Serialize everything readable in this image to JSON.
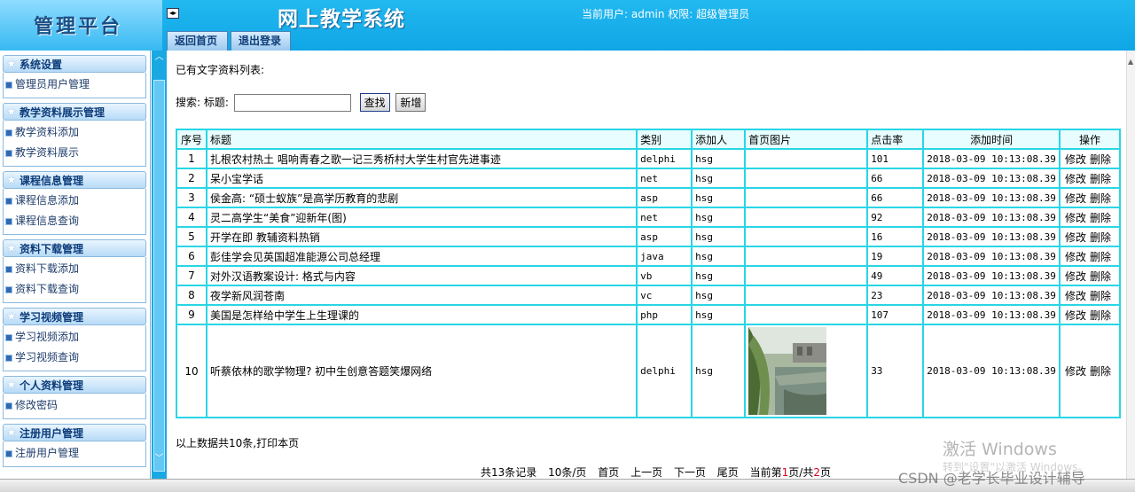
{
  "header": {
    "logo_text": "管理平台",
    "system_title": "网上教学系统",
    "user_info": "当前用户: admin 权限: 超级管理员",
    "tabs": [
      {
        "label": "返回首页"
      },
      {
        "label": "退出登录"
      }
    ]
  },
  "sidebar": {
    "groups": [
      {
        "title": "系统设置",
        "items": [
          {
            "label": "管理员用户管理"
          }
        ]
      },
      {
        "title": "教学资料展示管理",
        "items": [
          {
            "label": "教学资料添加"
          },
          {
            "label": "教学资料展示"
          }
        ]
      },
      {
        "title": "课程信息管理",
        "items": [
          {
            "label": "课程信息添加"
          },
          {
            "label": "课程信息查询"
          }
        ]
      },
      {
        "title": "资料下载管理",
        "items": [
          {
            "label": "资料下载添加"
          },
          {
            "label": "资料下载查询"
          }
        ]
      },
      {
        "title": "学习视频管理",
        "items": [
          {
            "label": "学习视频添加"
          },
          {
            "label": "学习视频查询"
          }
        ]
      },
      {
        "title": "个人资料管理",
        "items": [
          {
            "label": "修改密码"
          }
        ]
      },
      {
        "title": "注册用户管理",
        "items": [
          {
            "label": "注册用户管理"
          }
        ]
      }
    ]
  },
  "main": {
    "list_title": "已有文字资料列表:",
    "search": {
      "label": "搜索: 标题:",
      "value": "",
      "search_button": "查找",
      "add_button": "新增"
    },
    "table": {
      "headers": [
        "序号",
        "标题",
        "类别",
        "添加人",
        "首页图片",
        "点击率",
        "添加时间",
        "操作"
      ],
      "edit_label": "修改",
      "delete_label": "删除",
      "rows": [
        {
          "no": "1",
          "title": "扎根农村热土 唱响青春之歌一记三秀桥村大学生村官先进事迹",
          "category": "delphi",
          "author": "hsg",
          "image": "",
          "clicks": "101",
          "time": "2018-03-09 10:13:08.39"
        },
        {
          "no": "2",
          "title": "呆小宝学话",
          "category": "net",
          "author": "hsg",
          "image": "",
          "clicks": "66",
          "time": "2018-03-09 10:13:08.39"
        },
        {
          "no": "3",
          "title": "侯金高: “硕士蚁族”是高学历教育的悲剧",
          "category": "asp",
          "author": "hsg",
          "image": "",
          "clicks": "66",
          "time": "2018-03-09 10:13:08.39"
        },
        {
          "no": "4",
          "title": "灵二高学生“美食”迎新年(图)",
          "category": "net",
          "author": "hsg",
          "image": "",
          "clicks": "92",
          "time": "2018-03-09 10:13:08.39"
        },
        {
          "no": "5",
          "title": "开学在即 教辅资料热销",
          "category": "asp",
          "author": "hsg",
          "image": "",
          "clicks": "16",
          "time": "2018-03-09 10:13:08.39"
        },
        {
          "no": "6",
          "title": "彭佳学会见英国超准能源公司总经理",
          "category": "java",
          "author": "hsg",
          "image": "",
          "clicks": "19",
          "time": "2018-03-09 10:13:08.39"
        },
        {
          "no": "7",
          "title": "对外汉语教案设计: 格式与内容",
          "category": "vb",
          "author": "hsg",
          "image": "",
          "clicks": "49",
          "time": "2018-03-09 10:13:08.39"
        },
        {
          "no": "8",
          "title": "夜学新风润苍南",
          "category": "vc",
          "author": "hsg",
          "image": "",
          "clicks": "23",
          "time": "2018-03-09 10:13:08.39"
        },
        {
          "no": "9",
          "title": "美国是怎样给中学生上生理课的",
          "category": "php",
          "author": "hsg",
          "image": "",
          "clicks": "107",
          "time": "2018-03-09 10:13:08.39"
        },
        {
          "no": "10",
          "title": "听蔡依林的歌学物理? 初中生创意答题笑爆网络",
          "category": "delphi",
          "author": "hsg",
          "image": "landscape-photo",
          "clicks": "33",
          "time": "2018-03-09 10:13:08.39"
        }
      ]
    },
    "footer_note": "以上数据共10条,打印本页",
    "pager": {
      "total": "共13条记录",
      "per_page": "10条/页",
      "first": "首页",
      "prev": "上一页",
      "next": "下一页",
      "last": "尾页",
      "current_prefix": "当前第",
      "current_page": "1",
      "current_mid": "页/共",
      "total_pages": "2",
      "current_suffix": "页"
    }
  },
  "overlay": {
    "activate_windows": "激活 Windows",
    "activate_windows_sub": "转到\"设置\"以激活 Windows。",
    "csdn_watermark": "CSDN @老学长毕业设计辅导"
  },
  "colors": {
    "header_blue": "#0fa6e6",
    "table_border": "#28d6e6",
    "nav_dark": "#0d3c7a",
    "page_highlight": "#e0001b"
  }
}
